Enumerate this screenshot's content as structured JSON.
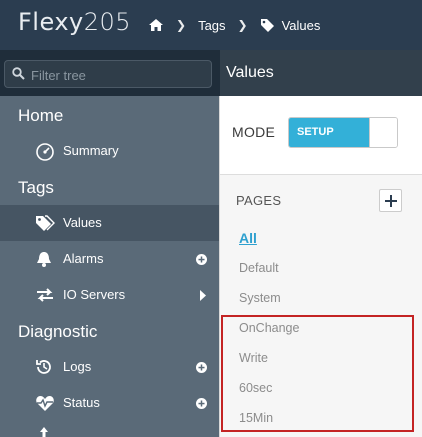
{
  "app": {
    "brand": "Flexy",
    "model": "205"
  },
  "breadcrumb": {
    "items": [
      "Tags",
      "Values"
    ]
  },
  "filter": {
    "placeholder": "Filter tree"
  },
  "header": {
    "title": "Values"
  },
  "sidebar": {
    "sections": [
      {
        "title": "Home",
        "items": [
          {
            "label": "Summary",
            "icon": "gauge-icon"
          }
        ]
      },
      {
        "title": "Tags",
        "items": [
          {
            "label": "Values",
            "icon": "tags-icon",
            "active": true
          },
          {
            "label": "Alarms",
            "icon": "bell-icon",
            "right": "plus-circle-icon"
          },
          {
            "label": "IO Servers",
            "icon": "swap-arrows-icon",
            "right": "caret-right-icon"
          }
        ]
      },
      {
        "title": "Diagnostic",
        "items": [
          {
            "label": "Logs",
            "icon": "history-icon",
            "right": "plus-circle-icon"
          },
          {
            "label": "Status",
            "icon": "heartbeat-icon",
            "right": "plus-circle-icon"
          }
        ]
      }
    ]
  },
  "mode": {
    "label": "MODE",
    "toggle_label": "SETUP",
    "toggle_on": true
  },
  "pages": {
    "label": "PAGES",
    "items": [
      "All",
      "Default",
      "System",
      "OnChange",
      "Write",
      "60sec",
      "15Min"
    ],
    "selected": "All"
  },
  "colors": {
    "topbar": "#2b3d50",
    "sidebar": "#5a6a78",
    "accent": "#33b0d8",
    "link": "#2ea0cf",
    "highlight": "#c42424"
  }
}
